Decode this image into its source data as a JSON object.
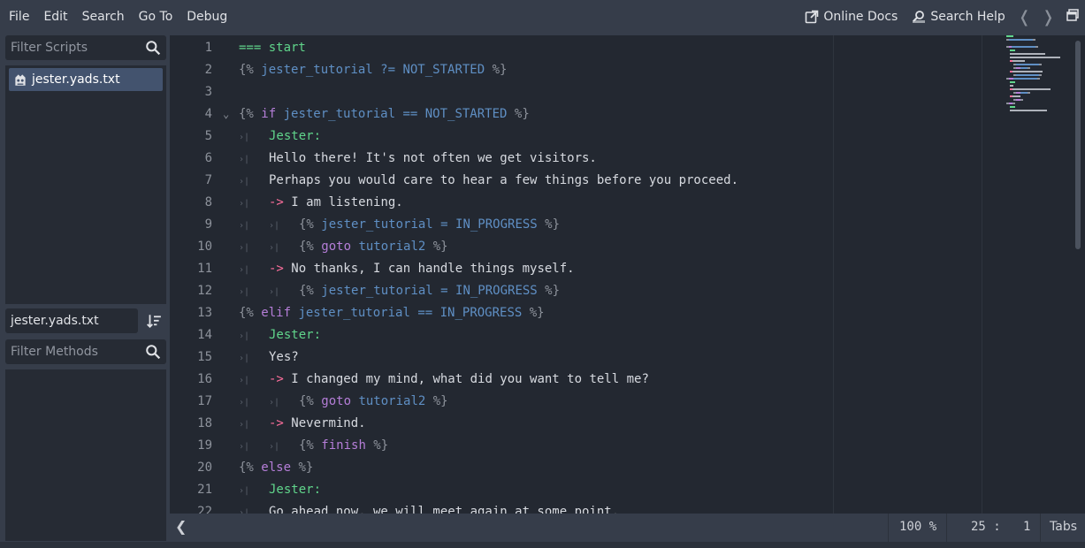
{
  "menu": [
    "File",
    "Edit",
    "Search",
    "Go To",
    "Debug"
  ],
  "toolbar": {
    "online_docs": "Online Docs",
    "search_help": "Search Help",
    "back_arrow": "❬",
    "forward_arrow": "❭"
  },
  "left": {
    "filter_scripts_placeholder": "Filter Scripts",
    "scripts": [
      "jester.yads.txt"
    ],
    "current_file": "jester.yads.txt",
    "filter_methods_placeholder": "Filter Methods"
  },
  "editor": {
    "lines": [
      {
        "n": "1",
        "fold": "",
        "indent": 0,
        "tokens": [
          [
            "=== start",
            "green"
          ]
        ]
      },
      {
        "n": "2",
        "fold": "",
        "indent": 0,
        "tokens": [
          [
            "{% ",
            "br"
          ],
          [
            "jester_tutorial ?= NOT_STARTED",
            "blue"
          ],
          [
            " %}",
            "br"
          ]
        ]
      },
      {
        "n": "3",
        "fold": "",
        "indent": 0,
        "tokens": []
      },
      {
        "n": "4",
        "fold": "⌄",
        "indent": 0,
        "tokens": [
          [
            "{% ",
            "br"
          ],
          [
            "if ",
            "kw"
          ],
          [
            "jester_tutorial == NOT_STARTED",
            "blue"
          ],
          [
            " %}",
            "br"
          ]
        ]
      },
      {
        "n": "5",
        "fold": "",
        "indent": 1,
        "tokens": [
          [
            "Jester:",
            "green"
          ]
        ]
      },
      {
        "n": "6",
        "fold": "",
        "indent": 1,
        "tokens": [
          [
            "Hello there! It's not often we get visitors.",
            "white"
          ]
        ]
      },
      {
        "n": "7",
        "fold": "",
        "indent": 1,
        "tokens": [
          [
            "Perhaps you would care to hear a few things before you proceed.",
            "white"
          ]
        ]
      },
      {
        "n": "8",
        "fold": "",
        "indent": 1,
        "tokens": [
          [
            "-> ",
            "pink"
          ],
          [
            "I am listening.",
            "white"
          ]
        ]
      },
      {
        "n": "9",
        "fold": "",
        "indent": 2,
        "tokens": [
          [
            "{% ",
            "br"
          ],
          [
            "jester_tutorial = IN_PROGRESS",
            "blue"
          ],
          [
            " %}",
            "br"
          ]
        ]
      },
      {
        "n": "10",
        "fold": "",
        "indent": 2,
        "tokens": [
          [
            "{% ",
            "br"
          ],
          [
            "goto ",
            "kw"
          ],
          [
            "tutorial2",
            "blue"
          ],
          [
            " %}",
            "br"
          ]
        ]
      },
      {
        "n": "11",
        "fold": "",
        "indent": 1,
        "tokens": [
          [
            "-> ",
            "pink"
          ],
          [
            "No thanks, I can handle things myself.",
            "white"
          ]
        ]
      },
      {
        "n": "12",
        "fold": "",
        "indent": 2,
        "tokens": [
          [
            "{% ",
            "br"
          ],
          [
            "jester_tutorial = IN_PROGRESS",
            "blue"
          ],
          [
            " %}",
            "br"
          ]
        ]
      },
      {
        "n": "13",
        "fold": "",
        "indent": 0,
        "tokens": [
          [
            "{% ",
            "br"
          ],
          [
            "elif ",
            "kw"
          ],
          [
            "jester_tutorial == IN_PROGRESS",
            "blue"
          ],
          [
            " %}",
            "br"
          ]
        ]
      },
      {
        "n": "14",
        "fold": "",
        "indent": 1,
        "tokens": [
          [
            "Jester:",
            "green"
          ]
        ]
      },
      {
        "n": "15",
        "fold": "",
        "indent": 1,
        "tokens": [
          [
            "Yes?",
            "white"
          ]
        ]
      },
      {
        "n": "16",
        "fold": "",
        "indent": 1,
        "tokens": [
          [
            "-> ",
            "pink"
          ],
          [
            "I changed my mind, what did you want to tell me?",
            "white"
          ]
        ]
      },
      {
        "n": "17",
        "fold": "",
        "indent": 2,
        "tokens": [
          [
            "{% ",
            "br"
          ],
          [
            "goto ",
            "kw"
          ],
          [
            "tutorial2",
            "blue"
          ],
          [
            " %}",
            "br"
          ]
        ]
      },
      {
        "n": "18",
        "fold": "",
        "indent": 1,
        "tokens": [
          [
            "-> ",
            "pink"
          ],
          [
            "Nevermind.",
            "white"
          ]
        ]
      },
      {
        "n": "19",
        "fold": "",
        "indent": 2,
        "tokens": [
          [
            "{% ",
            "br"
          ],
          [
            "finish",
            "kw"
          ],
          [
            " %}",
            "br"
          ]
        ]
      },
      {
        "n": "20",
        "fold": "",
        "indent": 0,
        "tokens": [
          [
            "{% ",
            "br"
          ],
          [
            "else",
            "kw"
          ],
          [
            " %}",
            "br"
          ]
        ]
      },
      {
        "n": "21",
        "fold": "",
        "indent": 1,
        "tokens": [
          [
            "Jester:",
            "green"
          ]
        ]
      },
      {
        "n": "22",
        "fold": "",
        "indent": 1,
        "tokens": [
          [
            "Go ahead now, we will meet again at some point.",
            "white"
          ]
        ]
      }
    ]
  },
  "status": {
    "back": "❮",
    "zoom": "100 %",
    "line": "25",
    "col": "1",
    "position_sep": ":",
    "indent": "Tabs"
  },
  "colors": {
    "green": "#60d58b",
    "blue": "#5f8fc4",
    "keyword": "#b57ed8",
    "arrow": "#ff6f9d",
    "selection": "#43536e"
  }
}
